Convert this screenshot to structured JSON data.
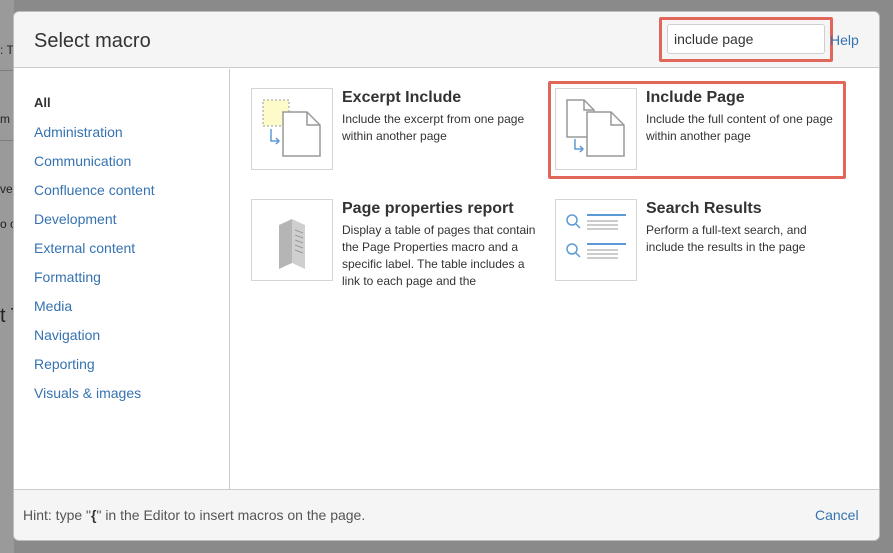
{
  "background_page": {
    "fragments": [
      ": T",
      "m",
      "ve",
      "o c",
      "t T"
    ]
  },
  "dialog": {
    "title": "Select macro",
    "search": {
      "value": "include page",
      "placeholder": ""
    },
    "help_label": "Help"
  },
  "sidebar": {
    "items": [
      {
        "label": "All",
        "active": true
      },
      {
        "label": "Administration"
      },
      {
        "label": "Communication"
      },
      {
        "label": "Confluence content"
      },
      {
        "label": "Development"
      },
      {
        "label": "External content"
      },
      {
        "label": "Formatting"
      },
      {
        "label": "Media"
      },
      {
        "label": "Navigation"
      },
      {
        "label": "Reporting"
      },
      {
        "label": "Visuals & images"
      }
    ]
  },
  "macros": [
    {
      "name": "Excerpt Include",
      "description": "Include the excerpt from one page within another page",
      "icon": "excerpt-include-icon"
    },
    {
      "name": "Include Page",
      "description": "Include the full content of one page within another page",
      "icon": "include-page-icon"
    },
    {
      "name": "Page properties report",
      "description": "Display a table of pages that contain the Page Properties macro and a specific label. The table includes a link to each page and the",
      "icon": "page-properties-report-icon"
    },
    {
      "name": "Search Results",
      "description": "Perform a full-text search, and include the results in the page",
      "icon": "search-results-icon"
    }
  ],
  "footer": {
    "hint_prefix": "Hint: type \"",
    "hint_key": "{",
    "hint_suffix": "\" in the Editor to insert macros on the page.",
    "cancel_label": "Cancel"
  },
  "colors": {
    "link": "#3572b0",
    "highlight": "#e0675a",
    "header_bg": "#f5f5f5",
    "excerpt_fill": "#fdfbc9"
  }
}
